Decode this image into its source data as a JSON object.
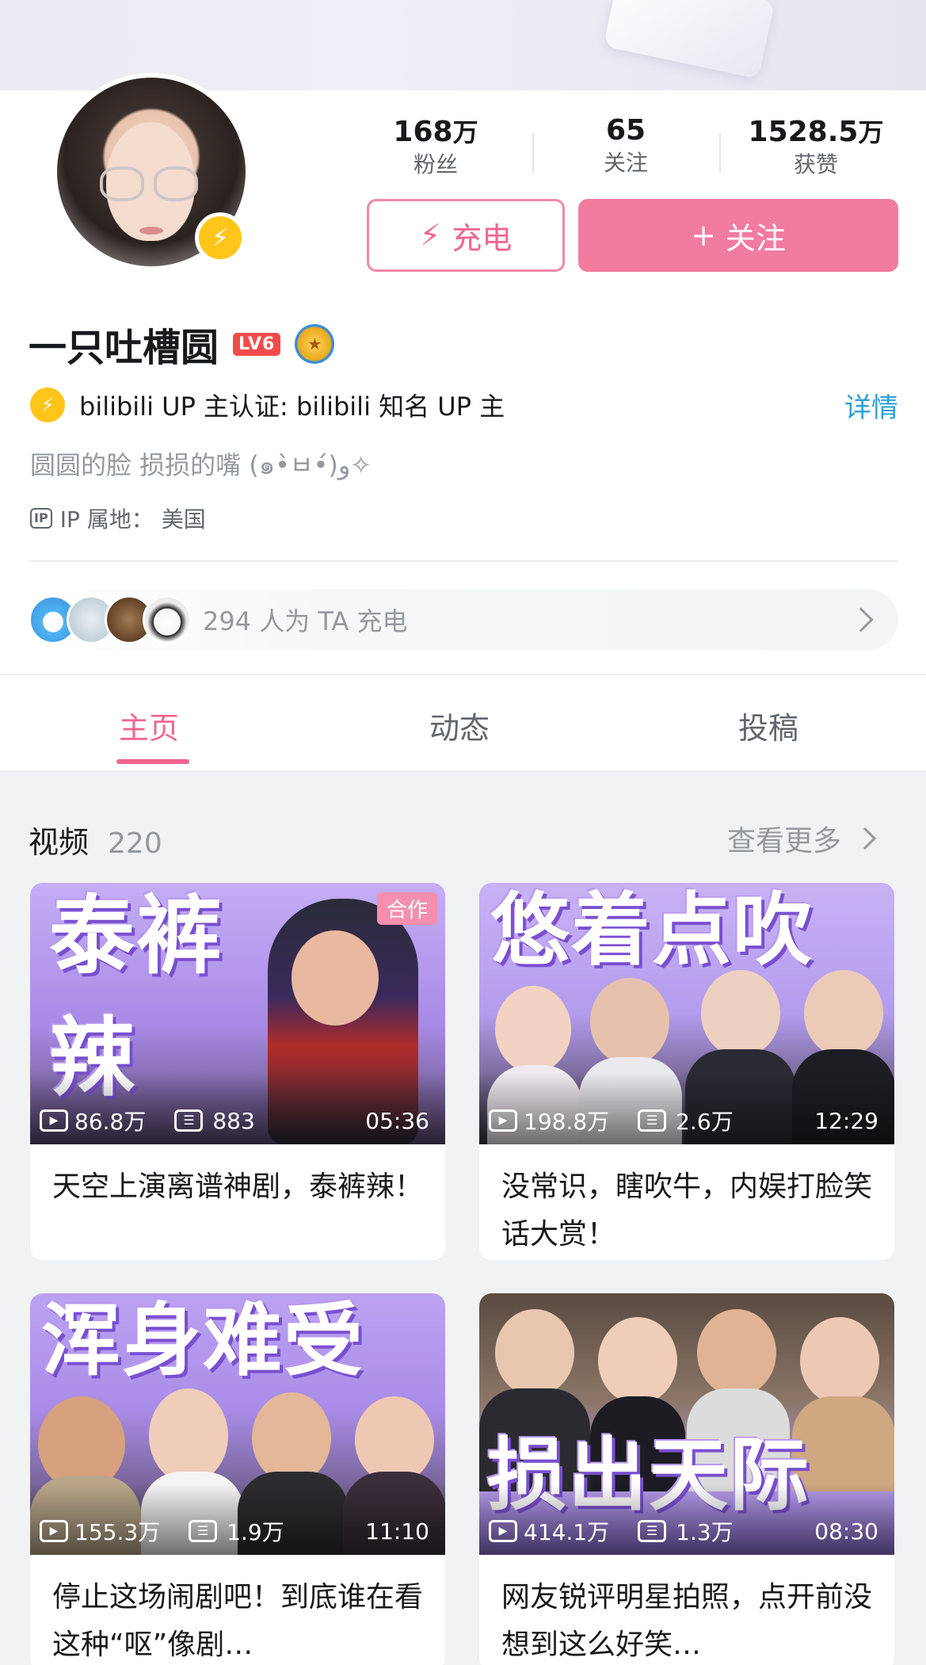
{
  "profile": {
    "name": "一只吐槽圆",
    "level": "LV6",
    "stats": [
      {
        "num": "168",
        "unit": "万",
        "label": "粉丝"
      },
      {
        "num": "65",
        "unit": "",
        "label": "关注"
      },
      {
        "num": "1528.5",
        "unit": "万",
        "label": "获赞"
      }
    ],
    "charge_button": "充电",
    "follow_button": "关注",
    "verify_text": "bilibili UP 主认证: bilibili 知名 UP 主",
    "detail_link": "详情",
    "sign": "圆圆的脸 损损的嘴 (๑•̀ㅂ•́)و✧",
    "ip_label": "IP 属地：",
    "ip_value": "美国",
    "charge_summary": "294 人为 TA 充电"
  },
  "tabs": [
    "主页",
    "动态",
    "投稿"
  ],
  "videos_section": {
    "title": "视频",
    "count": "220",
    "see_more": "查看更多"
  },
  "videos": [
    {
      "thumb_text": "泰裤辣",
      "views": "86.8万",
      "danmaku": "883",
      "duration": "05:36",
      "title": "天空上演离谱神剧，泰裤辣！",
      "coop": "合作"
    },
    {
      "thumb_text": "悠着点吹",
      "views": "198.8万",
      "danmaku": "2.6万",
      "duration": "12:29",
      "title": "没常识，瞎吹牛，内娱打脸笑话大赏！"
    },
    {
      "thumb_text": "浑身难受",
      "views": "155.3万",
      "danmaku": "1.9万",
      "duration": "11:10",
      "title": "停止这场闹剧吧！到底谁在看这种“呕”像剧…"
    },
    {
      "thumb_text": "损出天际",
      "views": "414.1万",
      "danmaku": "1.3万",
      "duration": "08:30",
      "title": "网友锐评明星拍照，点开前没想到这么好笑…"
    }
  ],
  "colors": {
    "accent": "#f0658f",
    "follow": "#f27ba0",
    "link": "#2a9fd8",
    "badge": "#ffc518"
  }
}
